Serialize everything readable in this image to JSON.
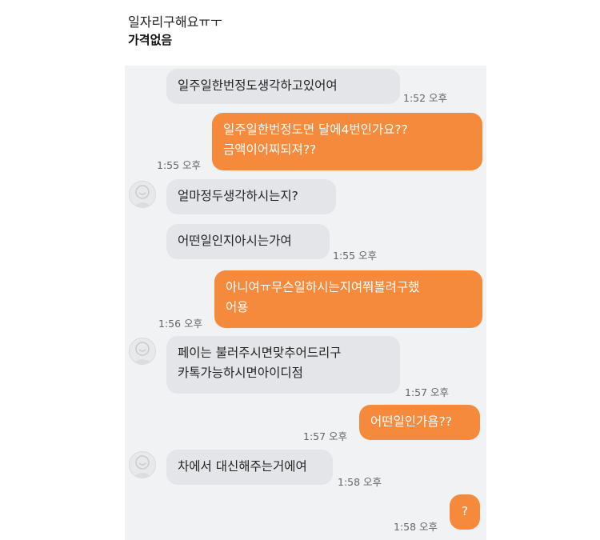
{
  "header": {
    "title": "일자리구해요ㅠㅜ",
    "price": "가격없음"
  },
  "colors": {
    "outgoing_bubble": "#f58a3c",
    "incoming_bubble": "#e4e5e8",
    "chat_background": "#f1f2f4"
  },
  "messages": [
    {
      "side": "in",
      "lines": [
        "일주일한번정도생각하고있어여"
      ],
      "time": "1:52 오후"
    },
    {
      "side": "out",
      "lines": [
        "일주일한번정도면 달에4번인가요??",
        "금액이어찌되져??"
      ],
      "time": "1:55 오후"
    },
    {
      "side": "in",
      "lines": [
        "얼마정두생각하시는지?"
      ],
      "time": ""
    },
    {
      "side": "in",
      "lines": [
        "어떤일인지아시는가여"
      ],
      "time": "1:55 오후"
    },
    {
      "side": "out",
      "lines": [
        "아니여ㅠ무슨일하시는지여쭤볼려구했",
        "어용"
      ],
      "time": "1:56 오후"
    },
    {
      "side": "in",
      "lines": [
        "페이는 불러주시면맞추어드리구",
        "카톡가능하시면아이디점"
      ],
      "time": "1:57 오후"
    },
    {
      "side": "out",
      "lines": [
        "어떤일인가욤??"
      ],
      "time": "1:57 오후"
    },
    {
      "side": "in",
      "lines": [
        "차에서 대신해주는거에여"
      ],
      "time": "1:58 오후"
    },
    {
      "side": "out",
      "lines": [
        "?"
      ],
      "time": "1:58 오후"
    }
  ]
}
